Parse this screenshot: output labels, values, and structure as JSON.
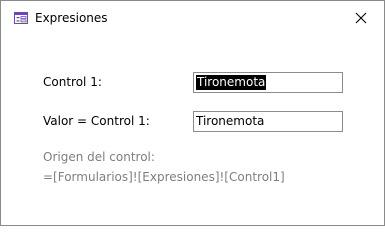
{
  "window": {
    "title": "Expresiones",
    "icon": "form-icon",
    "close_icon": "close-icon"
  },
  "form": {
    "control1": {
      "label": "Control 1:",
      "value": "Tironemota",
      "selected": true
    },
    "valor": {
      "label": "Valor = Control 1:",
      "value": "Tironemota"
    },
    "origin": {
      "label": "Origen del control:",
      "value": "=[Formularios]![Expresiones]![Control1]"
    }
  }
}
